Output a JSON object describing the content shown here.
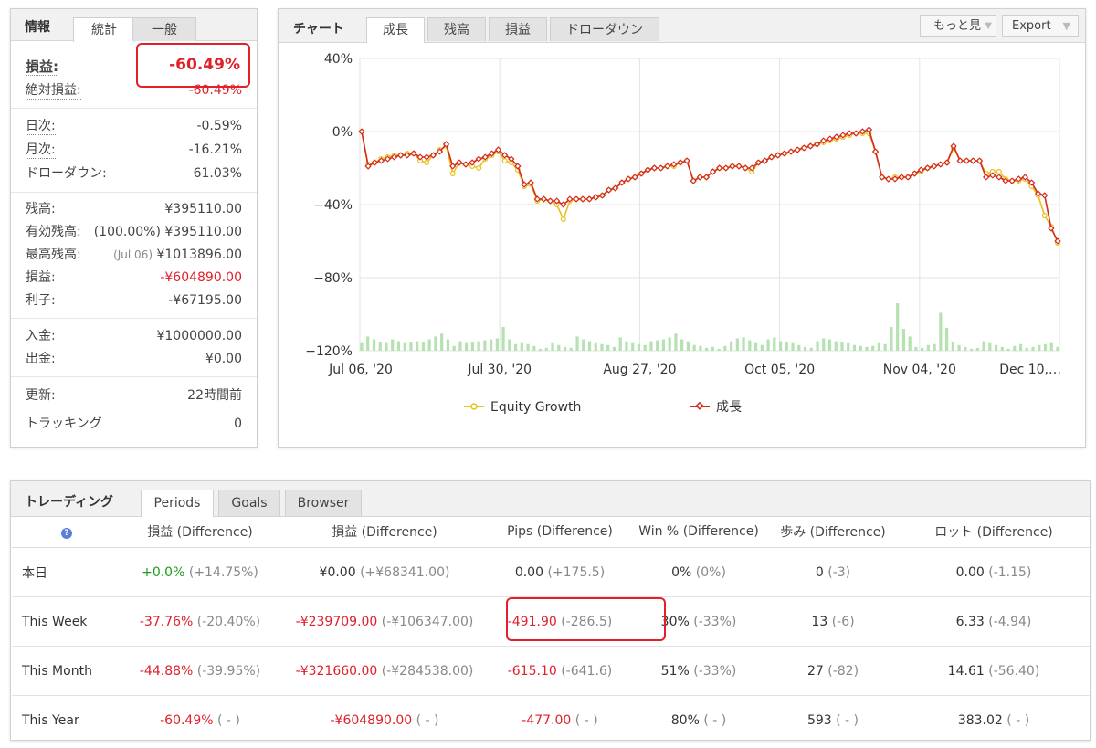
{
  "info": {
    "tabs": [
      "情報",
      "統計",
      "一般"
    ],
    "profit_label": "損益:",
    "profit_value": "-60.49%",
    "abs_profit_label": "絶対損益:",
    "abs_profit_value": "-60.49%",
    "daily_label": "日次:",
    "daily_value": "-0.59%",
    "monthly_label": "月次:",
    "monthly_value": "-16.21%",
    "drawdown_label": "ドローダウン:",
    "drawdown_value": "61.03%",
    "balance_label": "残高:",
    "balance_value": "¥395110.00",
    "equity_label": "有効残高:",
    "equity_pct": "(100.00%)",
    "equity_value": "¥395110.00",
    "highest_label": "最高残高:",
    "highest_date": "(Jul 06)",
    "highest_value": "¥1013896.00",
    "pl_label": "損益:",
    "pl_value": "-¥604890.00",
    "interest_label": "利子:",
    "interest_value": "-¥67195.00",
    "deposit_label": "入金:",
    "deposit_value": "¥1000000.00",
    "withdraw_label": "出金:",
    "withdraw_value": "¥0.00",
    "updated_label": "更新:",
    "updated_value": "22時間前",
    "tracking_label": "トラッキング",
    "tracking_value": "0"
  },
  "chart_panel": {
    "title": "チャート",
    "tabs": [
      "成長",
      "残高",
      "損益",
      "ドローダウン"
    ],
    "more_button": "もっと見",
    "export_button": "Export"
  },
  "chart_data": {
    "type": "line",
    "y_ticks": [
      "40%",
      "0%",
      "−40%",
      "−80%",
      "−120%"
    ],
    "ylim": [
      -120,
      40
    ],
    "x_ticks": [
      "Jul 06, '20",
      "Jul 30, '20",
      "Aug 27, '20",
      "Oct 05, '20",
      "Nov 04, '20",
      "Dec 10,…"
    ],
    "series": [
      {
        "name": "Equity Growth",
        "color": "#e8c11a",
        "values": [
          0,
          -18,
          -17,
          -15,
          -14,
          -13,
          -13,
          -12,
          -12,
          -16,
          -17,
          -13,
          -10,
          -8,
          -23,
          -17,
          -18,
          -19,
          -20,
          -15,
          -13,
          -11,
          -16,
          -17,
          -21,
          -30,
          -29,
          -38,
          -37,
          -38,
          -40,
          -48,
          -38,
          -37,
          -37,
          -37,
          -36,
          -35,
          -32,
          -31,
          -28,
          -26,
          -25,
          -23,
          -21,
          -20,
          -20,
          -19,
          -19,
          -17,
          -16,
          -27,
          -25,
          -25,
          -22,
          -20,
          -20,
          -19,
          -19,
          -20,
          -22,
          -17,
          -16,
          -14,
          -13,
          -12,
          -11,
          -10,
          -9,
          -8,
          -7,
          -6,
          -5,
          -4,
          -3,
          -2,
          -1,
          -1,
          -1,
          -11,
          -25,
          -26,
          -25,
          -25,
          -25,
          -23,
          -22,
          -20,
          -19,
          -18,
          -17,
          -9,
          -16,
          -16,
          -16,
          -16,
          -23,
          -22,
          -22,
          -26,
          -27,
          -27,
          -26,
          -30,
          -35,
          -46,
          -52,
          -61
        ]
      },
      {
        "name": "成長",
        "color": "#d42a1f",
        "values": [
          0,
          -19,
          -17,
          -16,
          -15,
          -14,
          -13,
          -13,
          -12,
          -14,
          -14,
          -13,
          -11,
          -7,
          -19,
          -17,
          -18,
          -17,
          -15,
          -14,
          -12,
          -10,
          -13,
          -15,
          -19,
          -29,
          -28,
          -37,
          -37,
          -38,
          -38,
          -40,
          -37,
          -37,
          -37,
          -37,
          -36,
          -35,
          -32,
          -31,
          -28,
          -26,
          -25,
          -23,
          -21,
          -20,
          -20,
          -19,
          -18,
          -17,
          -16,
          -27,
          -25,
          -25,
          -22,
          -20,
          -20,
          -19,
          -19,
          -20,
          -20,
          -17,
          -16,
          -14,
          -13,
          -12,
          -11,
          -10,
          -9,
          -8,
          -7,
          -5,
          -4,
          -3,
          -2,
          -1,
          -1,
          0,
          1,
          -11,
          -25,
          -26,
          -26,
          -25,
          -25,
          -23,
          -21,
          -20,
          -19,
          -18,
          -17,
          -8,
          -16,
          -16,
          -16,
          -16,
          -25,
          -24,
          -25,
          -27,
          -27,
          -26,
          -25,
          -28,
          -34,
          -35,
          -53,
          -60
        ]
      }
    ],
    "volume": [
      8,
      15,
      12,
      9,
      8,
      12,
      10,
      8,
      9,
      10,
      9,
      12,
      15,
      18,
      12,
      5,
      10,
      8,
      9,
      10,
      11,
      12,
      13,
      25,
      12,
      7,
      8,
      7,
      5,
      2,
      3,
      8,
      6,
      4,
      3,
      15,
      12,
      10,
      8,
      7,
      6,
      4,
      14,
      10,
      8,
      7,
      6,
      10,
      11,
      12,
      14,
      18,
      12,
      10,
      6,
      5,
      3,
      4,
      2,
      5,
      10,
      13,
      14,
      11,
      8,
      6,
      12,
      14,
      10,
      9,
      8,
      6,
      4,
      3,
      10,
      13,
      12,
      10,
      9,
      8,
      6,
      5,
      4,
      5,
      8,
      7,
      25,
      50,
      23,
      15,
      4,
      3,
      6,
      7,
      40,
      24,
      9,
      6,
      4,
      2,
      3,
      10,
      8,
      6,
      4,
      2,
      5,
      7,
      3,
      4,
      6,
      7,
      8,
      4
    ]
  },
  "chart_legend": {
    "equity": "Equity Growth",
    "growth": "成長"
  },
  "trading": {
    "title": "トレーディング",
    "tabs": [
      "Periods",
      "Goals",
      "Browser"
    ],
    "help_icon": "?",
    "headers": [
      "損益 (Difference)",
      "損益 (Difference)",
      "Pips (Difference)",
      "Win % (Difference)",
      "歩み (Difference)",
      "ロット (Difference)"
    ],
    "rows": [
      {
        "label": "本日",
        "c1": "+0.0%",
        "c1d": "(+14.75%)",
        "c2": "¥0.00",
        "c2d": "(+¥68341.00)",
        "c3": "0.00",
        "c3d": "(+175.5)",
        "c4": "0%",
        "c4d": "(0%)",
        "c5": "0",
        "c5d": "(-3)",
        "c6": "0.00",
        "c6d": "(-1.15)"
      },
      {
        "label": "This Week",
        "c1": "-37.76%",
        "c1d": "(-20.40%)",
        "c2": "-¥239709.00",
        "c2d": "(-¥106347.00)",
        "c3": "-491.90",
        "c3d": "(-286.5)",
        "c4": "30%",
        "c4d": "(-33%)",
        "c5": "13",
        "c5d": "(-6)",
        "c6": "6.33",
        "c6d": "(-4.94)"
      },
      {
        "label": "This Month",
        "c1": "-44.88%",
        "c1d": "(-39.95%)",
        "c2": "-¥321660.00",
        "c2d": "(-¥284538.00)",
        "c3": "-615.10",
        "c3d": "(-641.6)",
        "c4": "51%",
        "c4d": "(-33%)",
        "c5": "27",
        "c5d": "(-82)",
        "c6": "14.61",
        "c6d": "(-56.40)"
      },
      {
        "label": "This Year",
        "c1": "-60.49%",
        "c1d": "( - )",
        "c2": "-¥604890.00",
        "c2d": "( - )",
        "c3": "-477.00",
        "c3d": "( - )",
        "c4": "80%",
        "c4d": "( - )",
        "c5": "593",
        "c5d": "( - )",
        "c6": "383.02",
        "c6d": "( - )"
      }
    ]
  }
}
